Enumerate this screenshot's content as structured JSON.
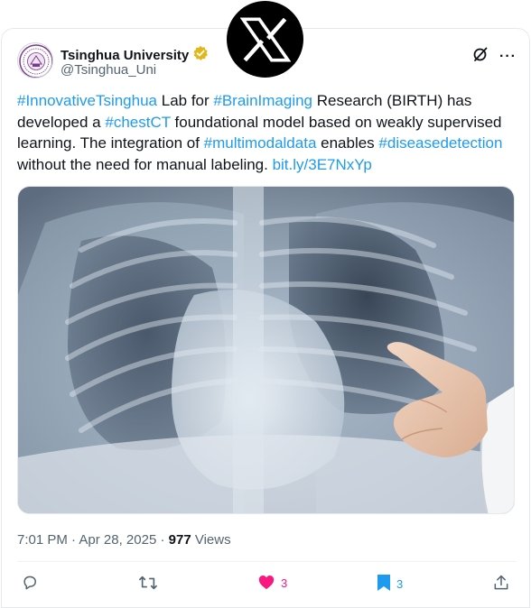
{
  "brand": {
    "logo_icon": "x-logo-icon"
  },
  "author": {
    "display_name": "Tsinghua University",
    "handle": "@Tsinghua_Uni",
    "verified_color": "#e2b719",
    "avatar_icon": "university-seal-icon"
  },
  "header_icons": [
    "grok-icon",
    "more-icon"
  ],
  "header_more_label": "···",
  "tweet": {
    "tag_innovative": "#InnovativeTsinghua",
    "text_1": " Lab for ",
    "tag_brain": "#BrainImaging",
    "text_2": " Research (BIRTH) has developed a ",
    "tag_chest": "#chestCT",
    "text_3": " foundational model based on weakly supervised learning. The integration of ",
    "tag_multi": "#multimodaldata",
    "text_4": " enables ",
    "tag_disease": "#diseasedetection",
    "text_5": " without the need for manual labeling. ",
    "link": "bit.ly/3E7NxYp"
  },
  "media": {
    "image_icon": "chest-xray-image"
  },
  "meta": {
    "time": "7:01 PM",
    "separator": " · ",
    "date": "Apr 28, 2025",
    "separator2": " · ",
    "views_count": "977",
    "views_label": " Views"
  },
  "actions": {
    "reply_count": "",
    "retweet_count": "",
    "like_count": "3",
    "bookmark_count": "3"
  },
  "colors": {
    "accent": "#1d9bf0",
    "like": "#f91880",
    "text": "#0f1419",
    "muted": "#536471"
  }
}
